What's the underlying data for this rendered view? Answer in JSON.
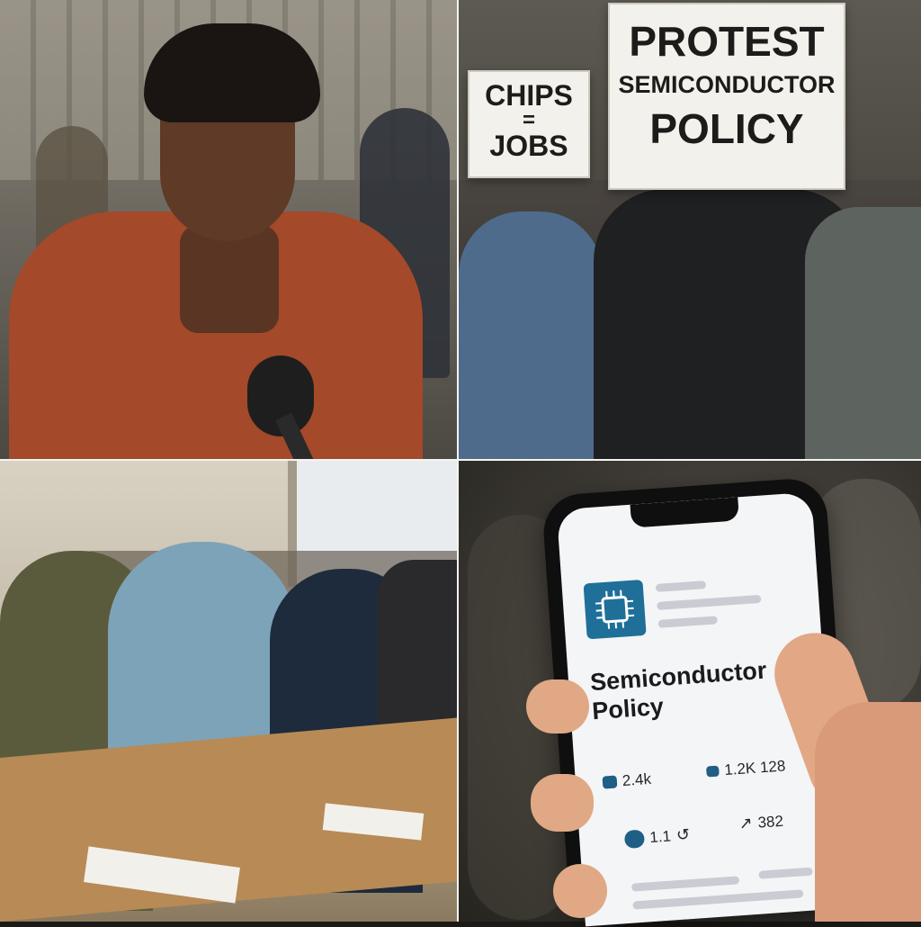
{
  "panels": {
    "top_left": {
      "scene": "interview",
      "colors": {
        "jacket": "#a4492a",
        "mic": "#1e1e1e"
      }
    },
    "top_right": {
      "scene": "protest",
      "signs": {
        "left": {
          "line1": "CHIPS",
          "line2": "=",
          "line3": "JOBS"
        },
        "right": {
          "line1": "PROTEST",
          "line2": "SEMICONDUCTOR",
          "line3": "POLICY"
        }
      }
    },
    "bottom_left": {
      "scene": "meeting",
      "colors": {
        "table": "#b88a55"
      }
    },
    "bottom_right": {
      "scene": "phone",
      "post": {
        "title_line1": "Semiconductor",
        "title_line2": "Policy",
        "likes": "2.4k",
        "comments": "1.2K 128",
        "shares": "1.1",
        "trend": "382"
      },
      "icons": [
        "chip-icon",
        "thumbs-up-icon",
        "comment-icon",
        "message-icon",
        "repost-icon",
        "trend-icon"
      ]
    }
  },
  "colors": {
    "accent": "#1f6f99",
    "screen": "#f4f5f7"
  }
}
